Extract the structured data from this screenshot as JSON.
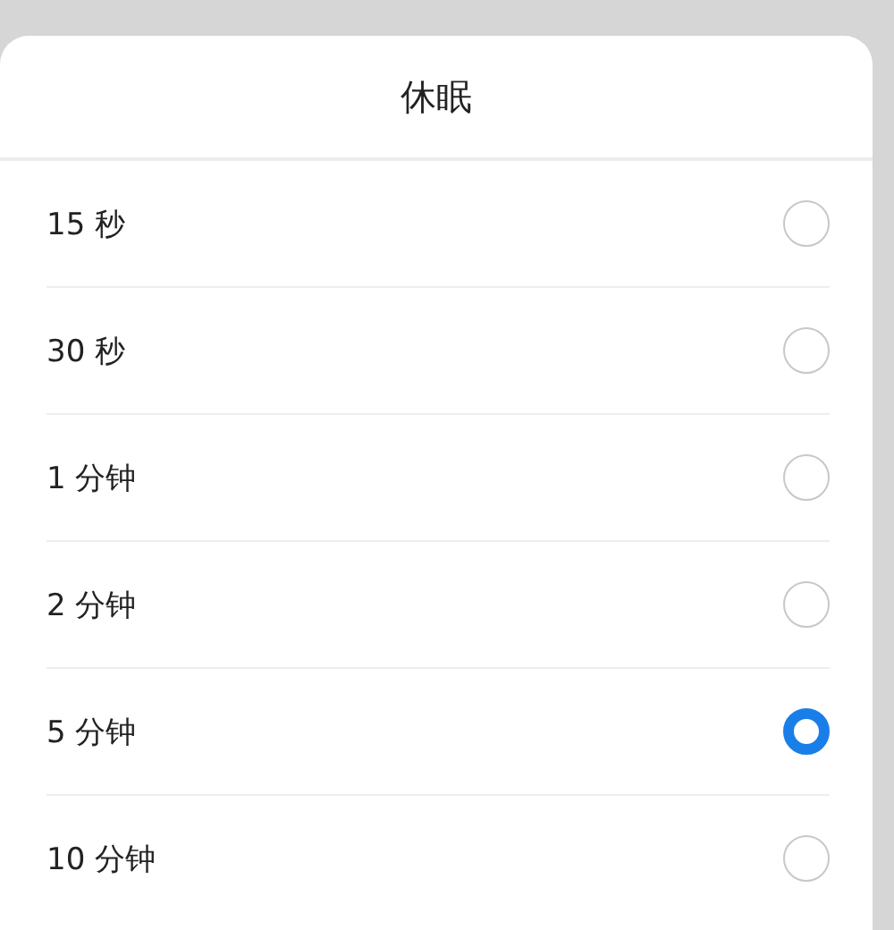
{
  "dialog": {
    "title": "休眠",
    "options": [
      {
        "label": "15 秒",
        "selected": false
      },
      {
        "label": "30 秒",
        "selected": false
      },
      {
        "label": "1 分钟",
        "selected": false
      },
      {
        "label": "2 分钟",
        "selected": false
      },
      {
        "label": "5 分钟",
        "selected": true
      },
      {
        "label": "10 分钟",
        "selected": false
      }
    ]
  }
}
